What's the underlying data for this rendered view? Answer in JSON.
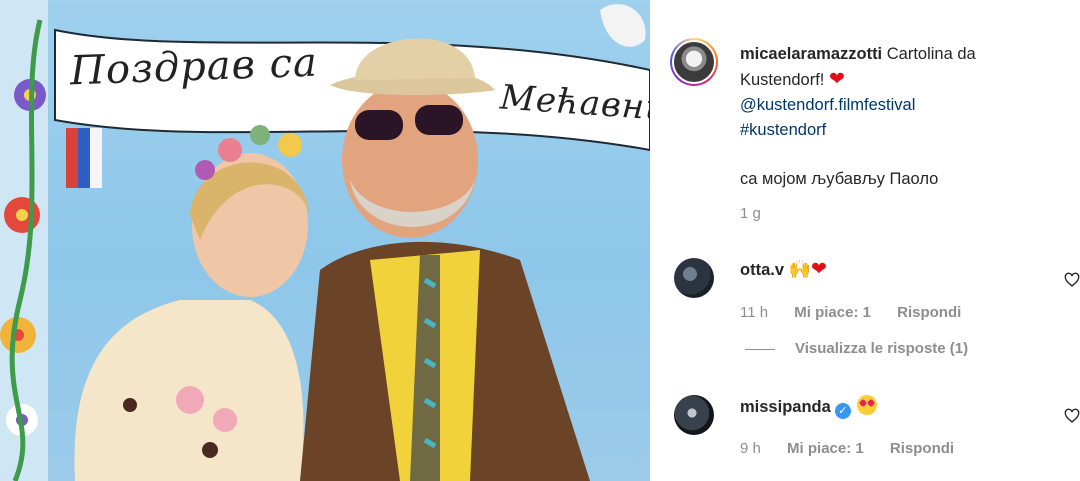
{
  "post": {
    "author": "micaelaramazzotti",
    "caption_line1": "Cartolina da Kustendorf!",
    "heart": "❤",
    "mentions": [
      "@kustendorf.filmfestival",
      "#kustendorf"
    ],
    "caption_line2": "са мојом љубављу Паоло",
    "timestamp": "1 g",
    "image_banner_text_left": "Поздрав са",
    "image_banner_text_right": "Мећавник"
  },
  "comments": [
    {
      "user": "otta.v",
      "emoji": "🙌",
      "heart": "❤",
      "time": "11 h",
      "likes": "Mi piace: 1",
      "reply": "Rispondi",
      "view_replies": "Visualizza le risposte (1)"
    },
    {
      "user": "missipanda",
      "verified": "✓",
      "time": "9 h",
      "likes": "Mi piace: 1",
      "reply": "Rispondi"
    }
  ],
  "colors": {
    "link": "#00376b",
    "meta": "#8e8e8e",
    "heart": "#e0101a",
    "verified": "#3897f0"
  },
  "icons": [
    "heart-outline-icon",
    "verified-badge-icon"
  ]
}
